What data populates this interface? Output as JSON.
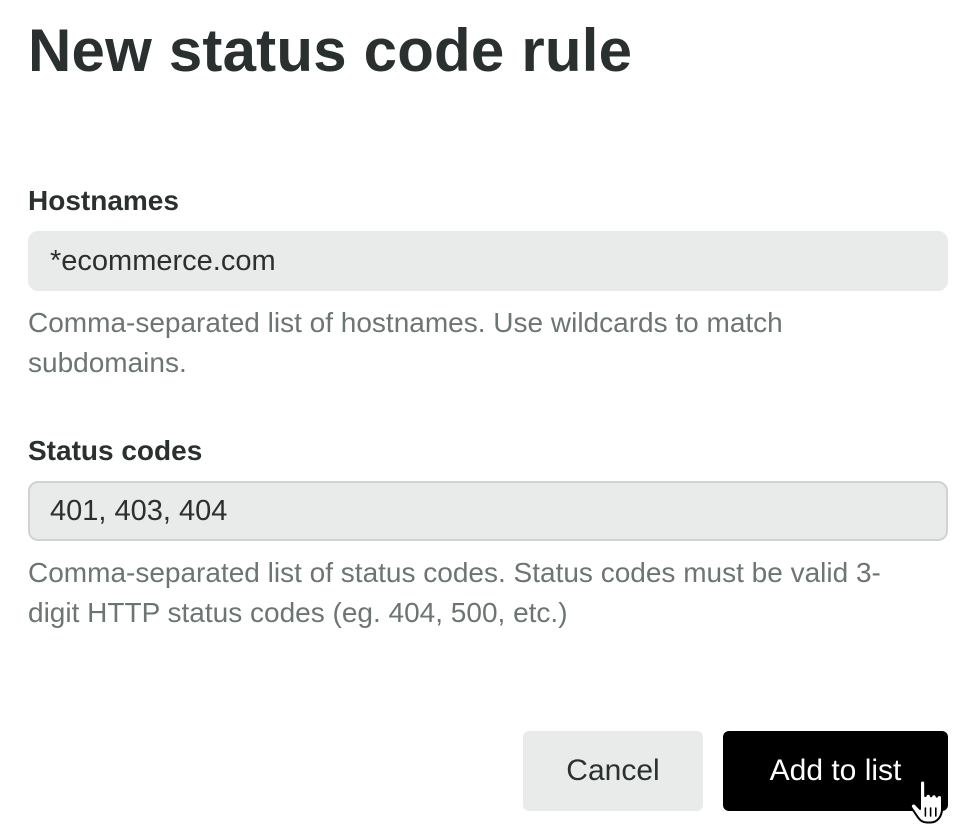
{
  "dialog": {
    "title": "New status code rule"
  },
  "hostnames": {
    "label": "Hostnames",
    "value": "*ecommerce.com",
    "help": "Comma-separated list of hostnames. Use wildcards to match subdomains."
  },
  "status_codes": {
    "label": "Status codes",
    "value": "401, 403, 404",
    "help": "Comma-separated list of status codes. Status codes must be valid 3-digit HTTP status codes (eg. 404, 500, etc.)"
  },
  "actions": {
    "cancel_label": "Cancel",
    "submit_label": "Add to list"
  },
  "cursor": {
    "icon": "hand-pointer-icon"
  },
  "colors": {
    "primary_button": "#000000",
    "secondary_button": "#e9ebeb",
    "input_background": "#e9ebeb",
    "help_text": "#6d7574",
    "title_text": "#2a302f"
  }
}
